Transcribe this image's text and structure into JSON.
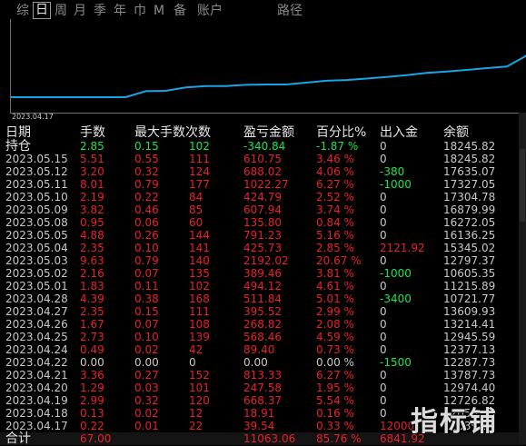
{
  "tabs": [
    "综",
    "日",
    "周",
    "月",
    "季",
    "年",
    "巾",
    "M",
    "备",
    "账户",
    "路径"
  ],
  "active_tab": "日",
  "chart": {
    "start_label": "2023.04.17",
    "line_color": "#1aa3e6",
    "values": [
      12000,
      12000,
      12000,
      12000,
      12800,
      12850,
      13300,
      13500,
      13500,
      13650,
      13700,
      13700,
      13950,
      14200,
      14300,
      14500,
      14700,
      14950,
      15250,
      15450,
      15650,
      15900,
      16100,
      17600
    ]
  },
  "headers": {
    "date": "日期",
    "lots": "手数",
    "max_lots": "最大手数",
    "count": "次数",
    "profit": "盈亏金额",
    "percent": "百分比%",
    "deposit": "出入金",
    "balance": "余额"
  },
  "colors": {
    "positive": "#19e64c",
    "negative": "#e8202a",
    "neutral": "#c8c8c8"
  },
  "hold": {
    "date": "持仓",
    "lots": "2.85",
    "max_lots": "0.15",
    "count": "102",
    "profit": "-340.84",
    "percent": "-1.87 %",
    "deposit": "0",
    "balance": "18245.82",
    "color": "green"
  },
  "rows": [
    {
      "date": "2023.05.15",
      "lots": "5.51",
      "max_lots": "0.55",
      "count": "111",
      "profit": "610.75",
      "percent": "3.46 %",
      "deposit": "0",
      "balance": "18245.82",
      "color": "red",
      "dep_color": "white"
    },
    {
      "date": "2023.05.12",
      "lots": "3.20",
      "max_lots": "0.32",
      "count": "124",
      "profit": "688.02",
      "percent": "4.06 %",
      "deposit": "-380",
      "balance": "17635.07",
      "color": "red",
      "dep_color": "green"
    },
    {
      "date": "2023.05.11",
      "lots": "8.01",
      "max_lots": "0.79",
      "count": "177",
      "profit": "1022.27",
      "percent": "6.27 %",
      "deposit": "-1000",
      "balance": "17327.05",
      "color": "red",
      "dep_color": "green"
    },
    {
      "date": "2023.05.10",
      "lots": "2.19",
      "max_lots": "0.22",
      "count": "84",
      "profit": "424.79",
      "percent": "2.52 %",
      "deposit": "0",
      "balance": "17304.78",
      "color": "red",
      "dep_color": "white"
    },
    {
      "date": "2023.05.09",
      "lots": "3.82",
      "max_lots": "0.46",
      "count": "85",
      "profit": "607.94",
      "percent": "3.74 %",
      "deposit": "0",
      "balance": "16879.99",
      "color": "red",
      "dep_color": "white"
    },
    {
      "date": "2023.05.08",
      "lots": "0.95",
      "max_lots": "0.06",
      "count": "60",
      "profit": "135.80",
      "percent": "0.84 %",
      "deposit": "0",
      "balance": "16272.05",
      "color": "red",
      "dep_color": "white"
    },
    {
      "date": "2023.05.05",
      "lots": "4.88",
      "max_lots": "0.26",
      "count": "144",
      "profit": "791.23",
      "percent": "5.16 %",
      "deposit": "0",
      "balance": "16136.25",
      "color": "red",
      "dep_color": "white"
    },
    {
      "date": "2023.05.04",
      "lots": "2.35",
      "max_lots": "0.10",
      "count": "141",
      "profit": "425.73",
      "percent": "2.85 %",
      "deposit": "2121.92",
      "balance": "15345.02",
      "color": "red",
      "dep_color": "red"
    },
    {
      "date": "2023.05.03",
      "lots": "9.63",
      "max_lots": "0.79",
      "count": "140",
      "profit": "2192.02",
      "percent": "20.67 %",
      "deposit": "0",
      "balance": "12797.37",
      "color": "red",
      "dep_color": "white"
    },
    {
      "date": "2023.05.02",
      "lots": "2.16",
      "max_lots": "0.07",
      "count": "135",
      "profit": "389.46",
      "percent": "3.81 %",
      "deposit": "-1000",
      "balance": "10605.35",
      "color": "red",
      "dep_color": "green"
    },
    {
      "date": "2023.05.01",
      "lots": "1.83",
      "max_lots": "0.11",
      "count": "102",
      "profit": "494.12",
      "percent": "4.61 %",
      "deposit": "0",
      "balance": "11215.89",
      "color": "red",
      "dep_color": "white"
    },
    {
      "date": "2023.04.28",
      "lots": "4.39",
      "max_lots": "0.38",
      "count": "168",
      "profit": "511.84",
      "percent": "5.01 %",
      "deposit": "-3400",
      "balance": "10721.77",
      "color": "red",
      "dep_color": "green"
    },
    {
      "date": "2023.04.27",
      "lots": "2.35",
      "max_lots": "0.15",
      "count": "111",
      "profit": "395.52",
      "percent": "2.99 %",
      "deposit": "0",
      "balance": "13609.93",
      "color": "red",
      "dep_color": "white"
    },
    {
      "date": "2023.04.26",
      "lots": "1.67",
      "max_lots": "0.07",
      "count": "108",
      "profit": "268.82",
      "percent": "2.08 %",
      "deposit": "0",
      "balance": "13214.41",
      "color": "red",
      "dep_color": "white"
    },
    {
      "date": "2023.04.25",
      "lots": "2.73",
      "max_lots": "0.10",
      "count": "139",
      "profit": "568.46",
      "percent": "4.59 %",
      "deposit": "0",
      "balance": "12945.59",
      "color": "red",
      "dep_color": "white"
    },
    {
      "date": "2023.04.24",
      "lots": "0.49",
      "max_lots": "0.02",
      "count": "42",
      "profit": "89.40",
      "percent": "0.73 %",
      "deposit": "0",
      "balance": "12377.13",
      "color": "red",
      "dep_color": "white"
    },
    {
      "date": "2023.04.22",
      "lots": "0.00",
      "max_lots": "0.00",
      "count": "0",
      "profit": "0.00",
      "percent": "0.00 %",
      "deposit": "-1500",
      "balance": "12287.73",
      "color": "white",
      "dep_color": "green"
    },
    {
      "date": "2023.04.21",
      "lots": "3.36",
      "max_lots": "0.27",
      "count": "152",
      "profit": "813.33",
      "percent": "6.27 %",
      "deposit": "0",
      "balance": "13787.73",
      "color": "red",
      "dep_color": "white"
    },
    {
      "date": "2023.04.20",
      "lots": "1.29",
      "max_lots": "0.03",
      "count": "101",
      "profit": "247.58",
      "percent": "1.95 %",
      "deposit": "0",
      "balance": "12974.40",
      "color": "red",
      "dep_color": "white"
    },
    {
      "date": "2023.04.19",
      "lots": "2.99",
      "max_lots": "0.32",
      "count": "120",
      "profit": "668.37",
      "percent": "5.54 %",
      "deposit": "0",
      "balance": "12726.82",
      "color": "red",
      "dep_color": "white"
    },
    {
      "date": "2023.04.18",
      "lots": "0.13",
      "max_lots": "0.02",
      "count": "12",
      "profit": "18.91",
      "percent": "0.16 %",
      "deposit": "0",
      "balance": "12058.45",
      "color": "red",
      "dep_color": "white"
    },
    {
      "date": "2023.04.17",
      "lots": "0.22",
      "max_lots": "0.01",
      "count": "22",
      "profit": "39.54",
      "percent": "0.33 %",
      "deposit": "12000",
      "balance": "12039.54",
      "color": "red",
      "dep_color": "red"
    }
  ],
  "total": {
    "date": "合计",
    "lots": "67.00",
    "max_lots": "",
    "count": "",
    "profit": "11063.06",
    "percent": "85.76 %",
    "deposit": "6841.92",
    "balance": "",
    "color": "red"
  },
  "watermark": "指标铺"
}
